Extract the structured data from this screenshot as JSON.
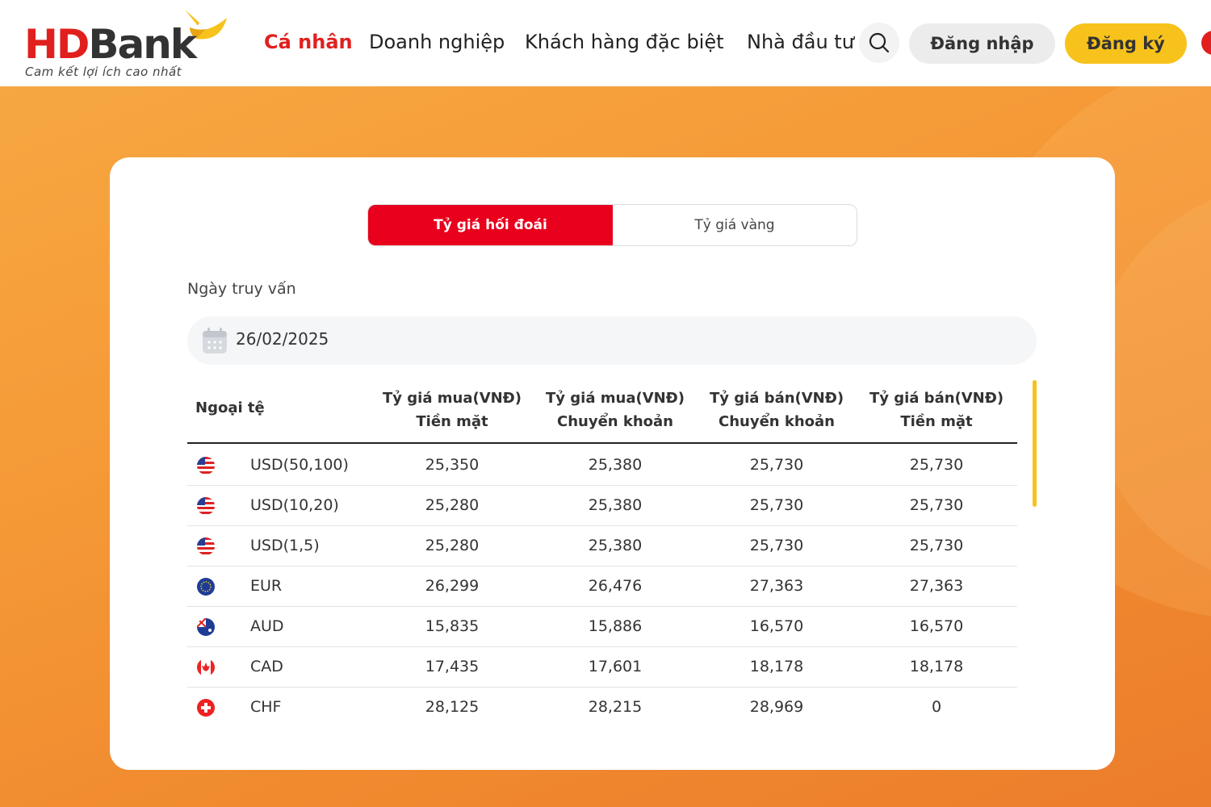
{
  "header": {
    "logo": {
      "hd": "HD",
      "bank": "Bank",
      "tagline": "Cam kết lợi ích cao nhất"
    },
    "nav": [
      {
        "label": "Cá nhân",
        "active": true
      },
      {
        "label": "Doanh nghiệp",
        "active": false
      },
      {
        "label": "Khách hàng đặc biệt",
        "active": false
      },
      {
        "label": "Nhà đầu tư",
        "active": false
      }
    ],
    "search_icon": "search-icon",
    "login_label": "Đăng nhập",
    "register_label": "Đăng ký"
  },
  "colors": {
    "brand_red": "#e8001c",
    "brand_yellow": "#f7c21b",
    "banner_orange": "#f59a37"
  },
  "tabs": [
    {
      "label": "Tỷ giá hối đoái",
      "active": true
    },
    {
      "label": "Tỷ giá vàng",
      "active": false
    }
  ],
  "query_date": {
    "label": "Ngày truy vấn",
    "value": "26/02/2025",
    "icon": "calendar-icon"
  },
  "table": {
    "headers": [
      {
        "line1": "Ngoại tệ",
        "line2": ""
      },
      {
        "line1": "Tỷ giá mua(VNĐ)",
        "line2": "Tiền mặt"
      },
      {
        "line1": "Tỷ giá mua(VNĐ)",
        "line2": "Chuyển khoản"
      },
      {
        "line1": "Tỷ giá bán(VNĐ)",
        "line2": "Chuyển khoản"
      },
      {
        "line1": "Tỷ giá bán(VNĐ)",
        "line2": "Tiền mặt"
      }
    ],
    "rows": [
      {
        "flag": "us-flag-icon",
        "currency": "USD(50,100)",
        "buy_cash": "25,350",
        "buy_transfer": "25,380",
        "sell_transfer": "25,730",
        "sell_cash": "25,730"
      },
      {
        "flag": "us-flag-icon",
        "currency": "USD(10,20)",
        "buy_cash": "25,280",
        "buy_transfer": "25,380",
        "sell_transfer": "25,730",
        "sell_cash": "25,730"
      },
      {
        "flag": "us-flag-icon",
        "currency": "USD(1,5)",
        "buy_cash": "25,280",
        "buy_transfer": "25,380",
        "sell_transfer": "25,730",
        "sell_cash": "25,730"
      },
      {
        "flag": "eu-flag-icon",
        "currency": "EUR",
        "buy_cash": "26,299",
        "buy_transfer": "26,476",
        "sell_transfer": "27,363",
        "sell_cash": "27,363"
      },
      {
        "flag": "au-flag-icon",
        "currency": "AUD",
        "buy_cash": "15,835",
        "buy_transfer": "15,886",
        "sell_transfer": "16,570",
        "sell_cash": "16,570"
      },
      {
        "flag": "ca-flag-icon",
        "currency": "CAD",
        "buy_cash": "17,435",
        "buy_transfer": "17,601",
        "sell_transfer": "18,178",
        "sell_cash": "18,178"
      },
      {
        "flag": "ch-flag-icon",
        "currency": "CHF",
        "buy_cash": "28,125",
        "buy_transfer": "28,215",
        "sell_transfer": "28,969",
        "sell_cash": "0"
      }
    ]
  }
}
